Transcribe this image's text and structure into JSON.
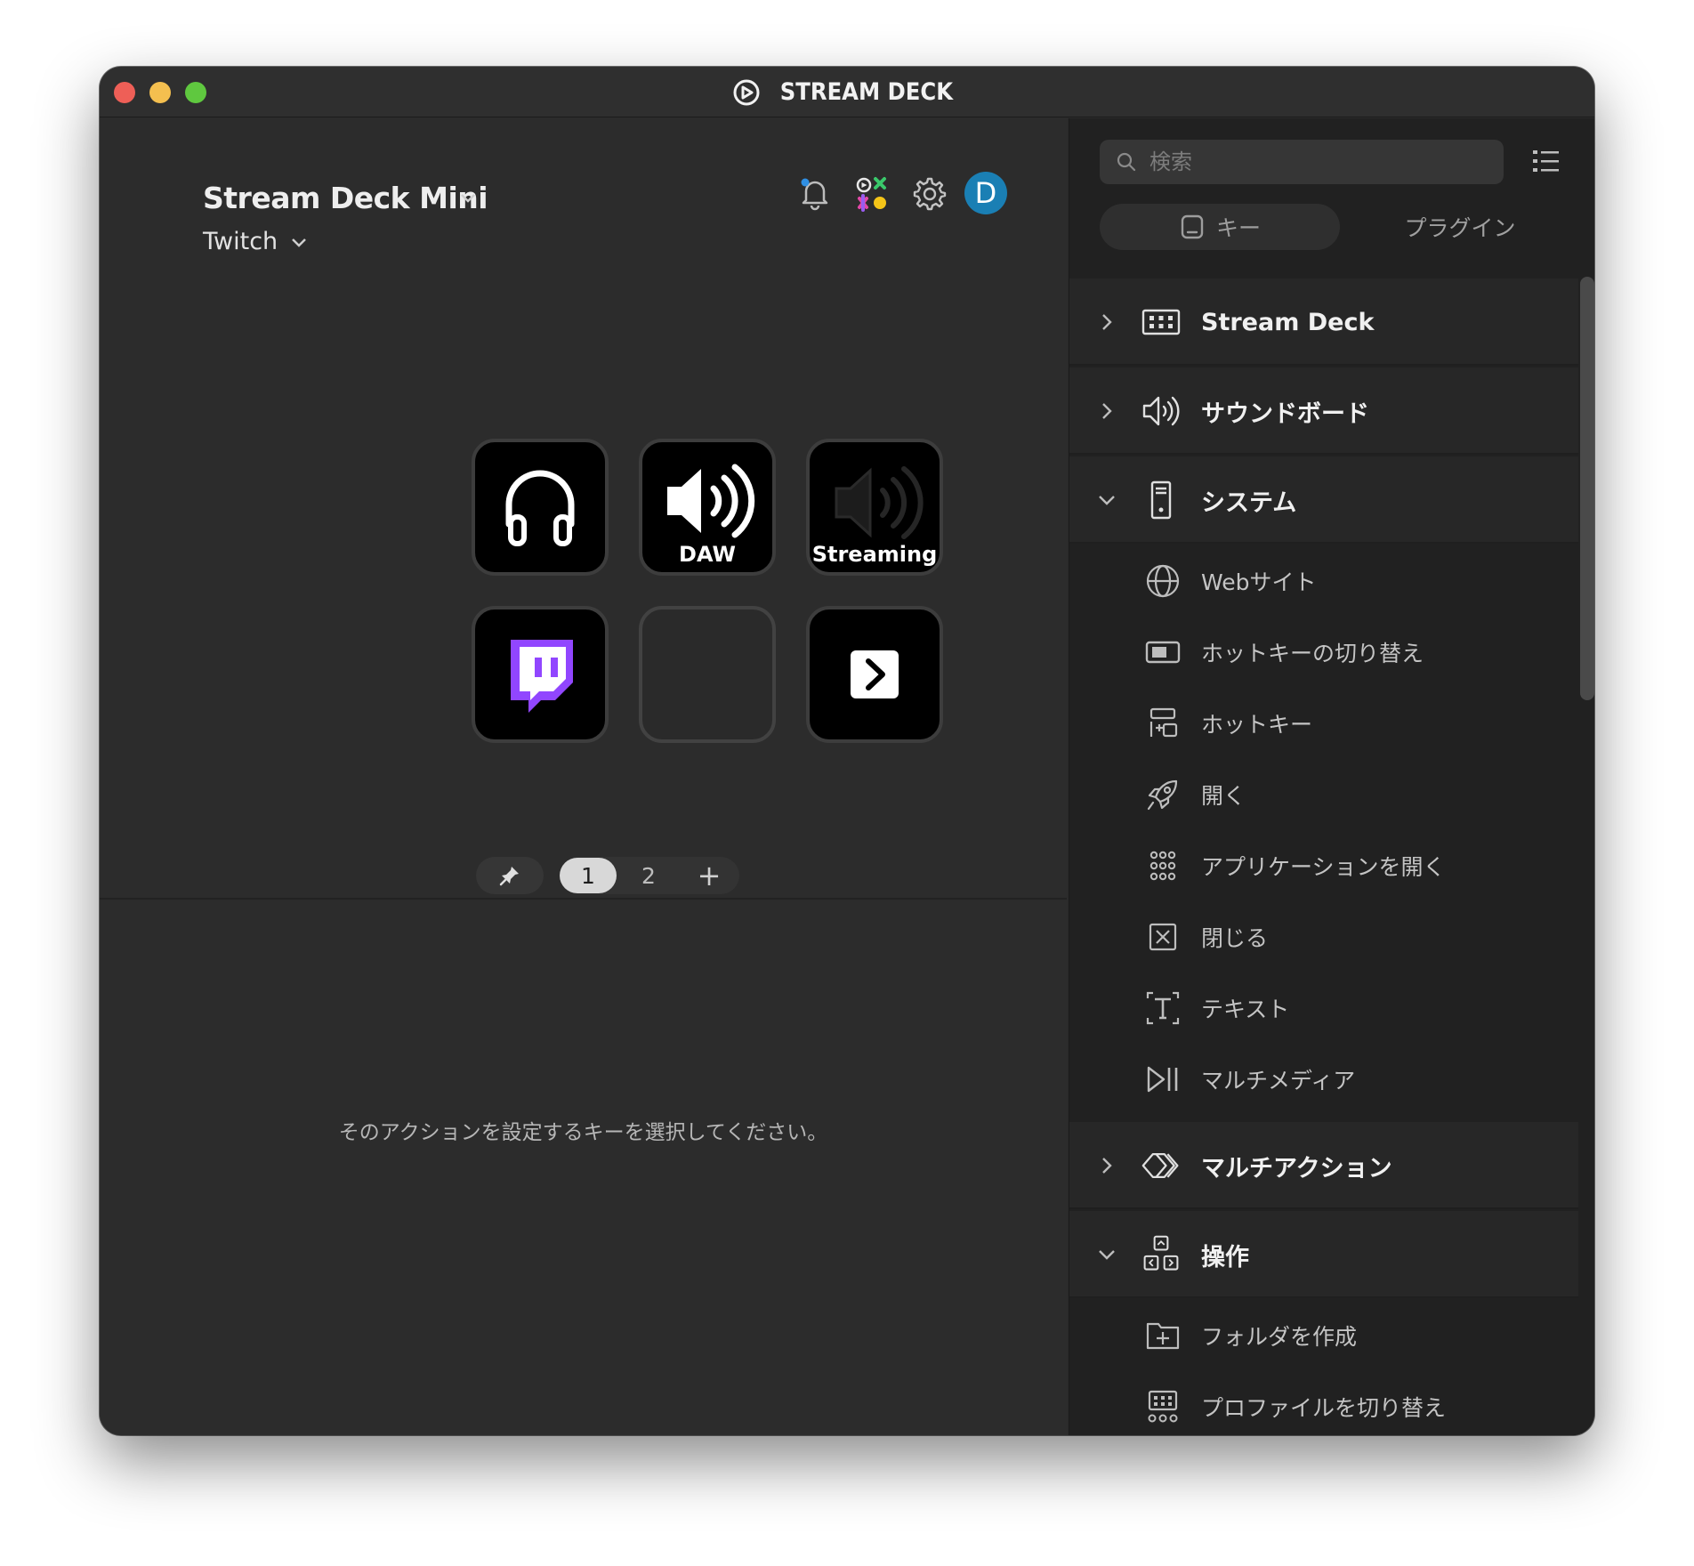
{
  "window": {
    "title": "STREAM DECK"
  },
  "device": {
    "name": "Stream Deck Mini",
    "profile": "Twitch"
  },
  "account": {
    "avatar_initial": "D"
  },
  "keys": [
    {
      "label": "",
      "icon": "headphones-icon"
    },
    {
      "label": "DAW",
      "icon": "speaker-icon"
    },
    {
      "label": "Streaming",
      "icon": "speaker-dim-icon"
    },
    {
      "label": "",
      "icon": "twitch-logo"
    },
    {
      "label": "",
      "icon": ""
    },
    {
      "label": "",
      "icon": "next-page-icon"
    }
  ],
  "pages": {
    "items": [
      "1",
      "2"
    ],
    "active": "1",
    "add": "+"
  },
  "hint": "そのアクションを設定するキーを選択してください。",
  "sidebar": {
    "search_placeholder": "検索",
    "tabs": {
      "keys": "キー",
      "plugins": "プラグイン"
    },
    "categories": {
      "stream_deck": "Stream Deck",
      "soundboard": "サウンドボード",
      "system": "システム",
      "multi_action": "マルチアクション",
      "operation": "操作"
    },
    "system_actions": [
      "Webサイト",
      "ホットキーの切り替え",
      "ホットキー",
      "開く",
      "アプリケーションを開く",
      "閉じる",
      "テキスト",
      "マルチメディア"
    ],
    "operation_actions": [
      "フォルダを作成",
      "プロファイルを切り替え"
    ]
  },
  "colors": {
    "avatar": "#1a7fb4",
    "twitch": "#9146ff"
  }
}
